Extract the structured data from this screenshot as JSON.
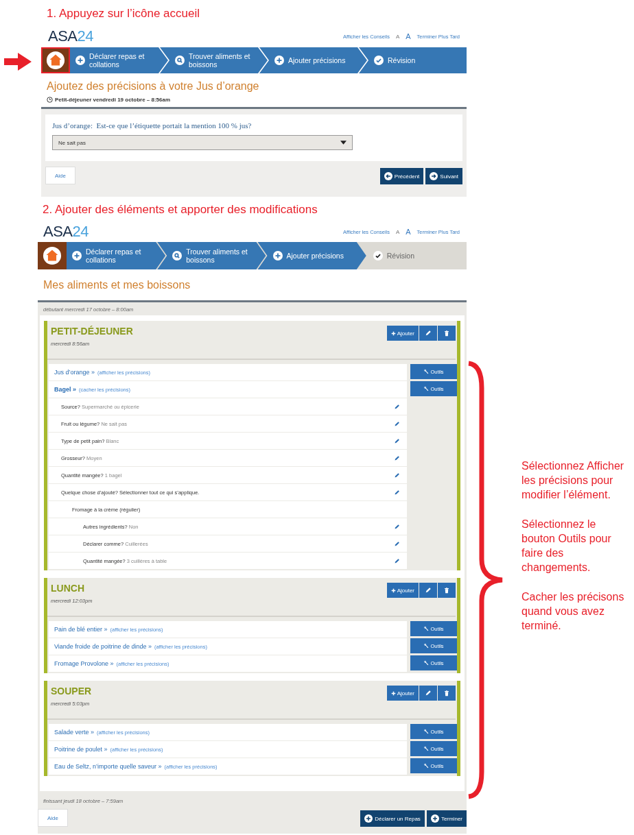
{
  "step1": {
    "title": "1. Appuyez sur l’icône accueil",
    "screen": {
      "logo": {
        "main": "ASA",
        "suffix": "24"
      },
      "top_links": {
        "tips": "Afficher les Conseils",
        "font_small": "A",
        "font_large": "A",
        "later": "Terminer Plus Tard"
      },
      "home": {
        "highlighted": true
      },
      "steps": [
        {
          "label": "Déclarer repas et collations",
          "active": true
        },
        {
          "label": "Trouver aliments et boissons",
          "active": true
        },
        {
          "label": "Ajouter précisions",
          "active": true
        },
        {
          "label": "Révision",
          "active": true
        }
      ],
      "heading": "Ajoutez des précisions à votre Jus d’orange",
      "meal_line": "Petit-déjeuner vendredi 19 octobre – 8:56am",
      "question": "Jus d’orange:  Est-ce que l’étiquette portait la mention 100 % jus?",
      "answer": {
        "value": "Ne sait pas"
      },
      "help": "Aide",
      "actions": [
        {
          "label": "Précédent"
        },
        {
          "label": "Suivant"
        }
      ]
    }
  },
  "step2": {
    "title": "2. Ajouter des éléments et apporter des modifications",
    "screen": {
      "logo": {
        "main": "ASA",
        "suffix": "24"
      },
      "top_links": {
        "tips": "Afficher les Conseils",
        "font_small": "A",
        "font_large": "A",
        "later": "Terminer Plus Tard"
      },
      "home": {
        "highlighted": false
      },
      "steps": [
        {
          "label": "Déclarer repas et collations",
          "active": true
        },
        {
          "label": "Trouver aliments et boissons",
          "active": true
        },
        {
          "label": "Ajouter précisions",
          "active": true
        },
        {
          "label": "Révision",
          "active": false
        }
      ],
      "heading": "Mes aliments et mes boissons",
      "start_line": "débutant mercredi 17 octobre – 8:00am",
      "meals": [
        {
          "name": "PETIT-DÉJEUNER",
          "time": "mercredi 8:56am",
          "add_label": "Ajouter",
          "items": [
            {
              "name": "Jus d’orange »",
              "toggle": "(afficher les précisions)",
              "expanded": false,
              "tools_label": "Outils"
            },
            {
              "name": "Bagel »",
              "toggle": "(cacher les précisions)",
              "expanded": true,
              "tools_label": "Outils",
              "details": [
                {
                  "label": "Source?",
                  "answer": "Supermarché ou épicerie",
                  "editable": true
                },
                {
                  "label": "Fruit ou légume?",
                  "answer": "Ne sait pas",
                  "editable": true
                },
                {
                  "label": "Type de petit pain?",
                  "answer": "Blanc",
                  "editable": true
                },
                {
                  "label": "Grosseur?",
                  "answer": "Moyen",
                  "editable": true
                },
                {
                  "label": "Quantité mangée?",
                  "answer": "1 bagel",
                  "editable": true
                },
                {
                  "label": "Quelque chose d’ajouté? Sélectionner tout ce qui s’applique.",
                  "editable": true,
                  "children": [
                    {
                      "label": "Fromage à la crème (régulier)",
                      "editable": false,
                      "children": [
                        {
                          "label": "Autres ingrédients?",
                          "answer": "Non",
                          "editable": true
                        },
                        {
                          "label": "Déclarer comme?",
                          "answer": "Cuillerées",
                          "editable": true
                        },
                        {
                          "label": "Quantité mangée?",
                          "answer": "3 cuillères à table",
                          "editable": true
                        }
                      ]
                    }
                  ]
                }
              ]
            }
          ]
        },
        {
          "name": "LUNCH",
          "time": "mercredi 12:03pm",
          "add_label": "Ajouter",
          "items": [
            {
              "name": "Pain de blé entier »",
              "toggle": "(afficher les précisions)",
              "expanded": false,
              "tools_label": "Outils"
            },
            {
              "name": "Viande froide de poitrine de dinde »",
              "toggle": "(afficher les précisions)",
              "expanded": false,
              "tools_label": "Outils"
            },
            {
              "name": "Fromage Provolone »",
              "toggle": "(afficher les précisions)",
              "expanded": false,
              "tools_label": "Outils"
            }
          ]
        },
        {
          "name": "SOUPER",
          "time": "mercredi 5:03pm",
          "add_label": "Ajouter",
          "items": [
            {
              "name": "Salade verte »",
              "toggle": "(afficher les précisions)",
              "expanded": false,
              "tools_label": "Outils"
            },
            {
              "name": "Poitrine de poulet »",
              "toggle": "(afficher les précisions)",
              "expanded": false,
              "tools_label": "Outils"
            },
            {
              "name": "Eau de Seltz, n’importe quelle saveur »",
              "toggle": "(afficher les précisions)",
              "expanded": false,
              "tools_label": "Outils"
            }
          ]
        }
      ],
      "end_line": "finissant jeudi 18 octobre – 7:59am",
      "help": "Aide",
      "actions": [
        {
          "label": "Déclarer un Repas"
        },
        {
          "label": "Terminer"
        }
      ]
    }
  },
  "callout": {
    "paragraphs": [
      "Sélectionnez Afficher les précisions pour modifier l’élément.",
      "Sélectionnez le bouton Outils pour faire des changements.",
      "Cacher les précisons quand vous avez terminé."
    ]
  }
}
